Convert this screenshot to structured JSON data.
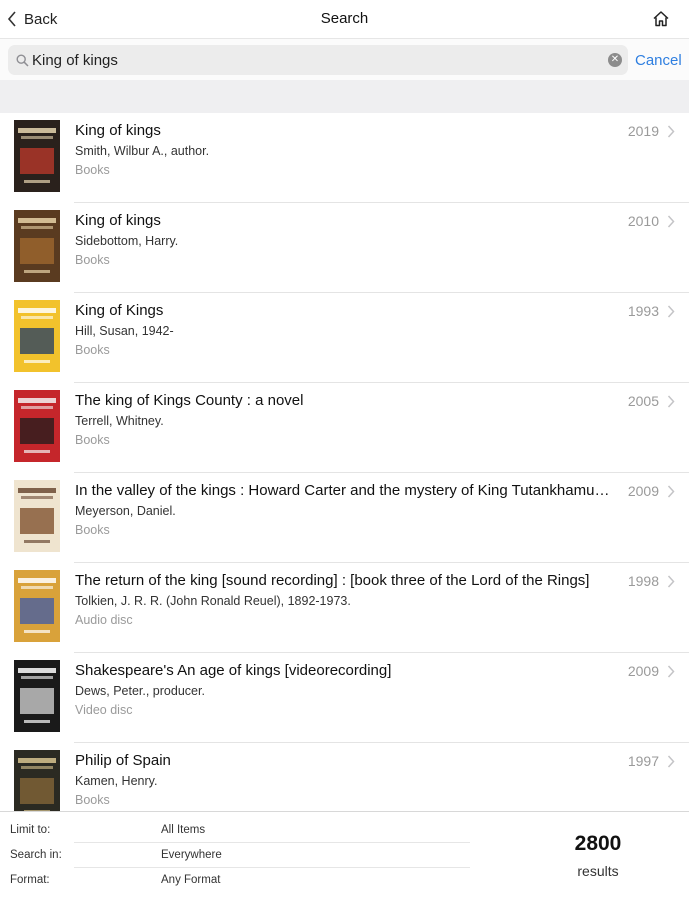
{
  "navbar": {
    "back_label": "Back",
    "title": "Search",
    "home_icon": "home-icon"
  },
  "search": {
    "query": "King of kings",
    "cancel_label": "Cancel",
    "clear_icon": "clear-icon"
  },
  "results": [
    {
      "title": "King of kings",
      "author": "Smith, Wilbur A., author.",
      "format": "Books",
      "year": "2019",
      "cover": {
        "bg": "#2a211c",
        "accent": "#c0392b",
        "text": "#e8d6b0"
      }
    },
    {
      "title": "King of kings",
      "author": "Sidebottom, Harry.",
      "format": "Books",
      "year": "2010",
      "cover": {
        "bg": "#5a3b20",
        "accent": "#a36b2f",
        "text": "#e7d3a8"
      }
    },
    {
      "title": "King of Kings",
      "author": "Hill, Susan, 1942-",
      "format": "Books",
      "year": "1993",
      "cover": {
        "bg": "#f2c22c",
        "accent": "#1f3a66",
        "text": "#ffffff"
      }
    },
    {
      "title": "The king of Kings County : a novel",
      "author": "Terrell, Whitney.",
      "format": "Books",
      "year": "2005",
      "cover": {
        "bg": "#c5262b",
        "accent": "#1c1c1c",
        "text": "#f2f2f2"
      }
    },
    {
      "title": "In the valley of the kings : Howard Carter and the mystery of King Tutankhamun's tomb",
      "author": "Meyerson, Daniel.",
      "format": "Books",
      "year": "2009",
      "cover": {
        "bg": "#efe4cf",
        "accent": "#7a4a25",
        "text": "#6b4a33"
      }
    },
    {
      "title": "The return of the king [sound recording] : [book three of the Lord of the Rings]",
      "author": "Tolkien, J. R. R. (John Ronald Reuel), 1892-1973.",
      "format": "Audio disc",
      "year": "1998",
      "cover": {
        "bg": "#d9a23a",
        "accent": "#3d5aa8",
        "text": "#ffffff"
      }
    },
    {
      "title": "Shakespeare's An age of kings [videorecording]",
      "author": "Dews, Peter., producer.",
      "format": "Video disc",
      "year": "2009",
      "cover": {
        "bg": "#1a1a1a",
        "accent": "#d8d8d8",
        "text": "#ffffff"
      }
    },
    {
      "title": "Philip of Spain",
      "author": "Kamen, Henry.",
      "format": "Books",
      "year": "1997",
      "cover": {
        "bg": "#2b2a22",
        "accent": "#8a6a3a",
        "text": "#d8c48f"
      }
    }
  ],
  "footer": {
    "limit_label": "Limit to:",
    "limit_value": "All Items",
    "search_in_label": "Search in:",
    "search_in_value": "Everywhere",
    "format_label": "Format:",
    "format_value": "Any Format",
    "count": "2800",
    "count_label": "results"
  },
  "colors": {
    "accent": "#2f7fe0",
    "separator": "#e4e4e4",
    "secondary_text": "#9a9a9a"
  }
}
